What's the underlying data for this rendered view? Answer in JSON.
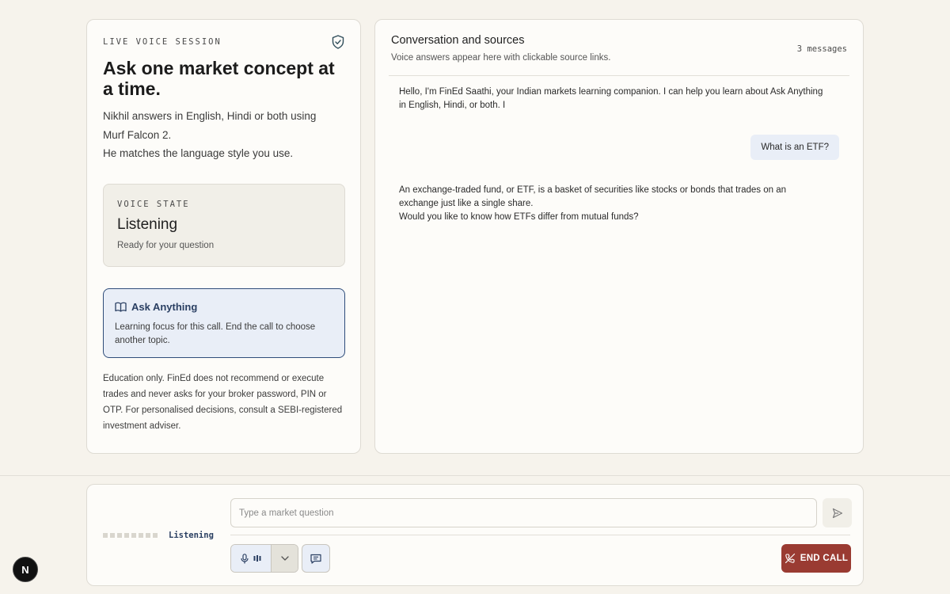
{
  "left_panel": {
    "eyebrow": "LIVE VOICE SESSION",
    "heading": "Ask one market concept at a time.",
    "intro_line1": "Nikhil answers in English, Hindi or both using Murf Falcon 2.",
    "intro_line2": "He matches the language style you use.",
    "voice_state": {
      "label": "VOICE STATE",
      "state": "Listening",
      "sub": "Ready for your question"
    },
    "focus": {
      "title": "Ask Anything",
      "description": "Learning focus for this call. End the call to choose another topic."
    },
    "disclaimer": "Education only. FinEd does not recommend or execute trades and never asks for your broker password, PIN or OTP. For personalised decisions, consult a SEBI-registered investment adviser."
  },
  "conversation": {
    "title": "Conversation and sources",
    "subtitle": "Voice answers appear here with clickable source links.",
    "count": "3 messages",
    "messages": [
      {
        "role": "assistant",
        "line1": "Hello, I'm FinEd Saathi, your Indian markets learning companion. I can help you learn about Ask Anything in English, Hindi, or both. I"
      },
      {
        "role": "user",
        "text": "What is an ETF?"
      },
      {
        "role": "assistant",
        "line1": "An exchange-traded fund, or ETF, is a basket of securities like stocks or bonds that trades on an exchange just like a single share.",
        "line2": "Would you like to know how ETFs differ from mutual funds?"
      }
    ]
  },
  "bottom": {
    "status": "Listening",
    "input_placeholder": "Type a market question",
    "end_call": "END CALL"
  },
  "badge": "N",
  "colors": {
    "accent_navy": "#2a3f62",
    "end_call": "#9a3b32",
    "user_bubble": "#e9eef7",
    "background": "#f6f3ec"
  },
  "icons": [
    "shield-check-icon",
    "book-open-icon",
    "send-icon",
    "microphone-icon",
    "audio-bars-icon",
    "chevron-down-icon",
    "chat-icon",
    "phone-off-icon"
  ]
}
